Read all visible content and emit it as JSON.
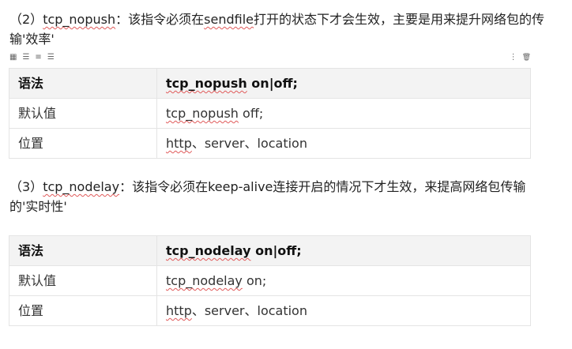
{
  "para1": {
    "prefix": "（2）",
    "code": "tcp_nopush",
    "mid": "：该指令必须在",
    "code2": "sendfile",
    "suffix": "打开的状态下才会生效，主要是用来提升网络包的传输'效率'"
  },
  "toolbar": {
    "grid_icon": "▦",
    "align_left_icon": "☰",
    "align_center_icon": "≡",
    "align_right_icon": "☰",
    "more_icon": "⋮",
    "delete_icon": "🗑"
  },
  "table1": {
    "header": {
      "c1": "语法",
      "cmd": "tcp_nopush",
      "rest": " on|off;"
    },
    "rows": [
      {
        "c1": "默认值",
        "cmd": "tcp_nopush",
        "rest": " off;"
      },
      {
        "c1": "位置",
        "cmd": "http",
        "rest": "、server、location"
      }
    ]
  },
  "para2": {
    "prefix": "（3）",
    "code": "tcp_nodelay",
    "suffix": "：该指令必须在keep-alive连接开启的情况下才生效，来提高网络包传输的'实时性'"
  },
  "table2": {
    "header": {
      "c1": "语法",
      "cmd": "tcp_nodelay",
      "rest": " on|off;"
    },
    "rows": [
      {
        "c1": "默认值",
        "cmd": "tcp_nodelay",
        "rest": " on;"
      },
      {
        "c1": "位置",
        "cmd": "http",
        "rest": "、server、location"
      }
    ]
  }
}
